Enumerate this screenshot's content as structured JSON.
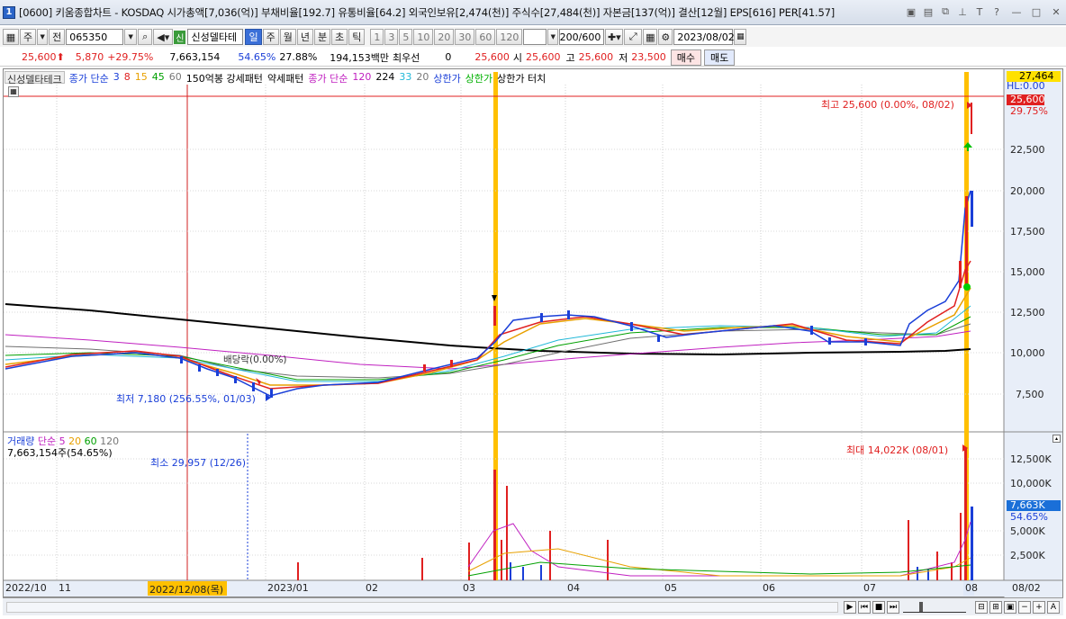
{
  "window": {
    "number": "1",
    "title": "[0600] 키움종합차트 - KOSDAQ 시가총액[7,036(억)] 부채비율[192.7] 유통비율[64.2] 외국인보유[2,474(천)] 주식수[27,484(천)] 자본금[137(억)] 결산[12월] EPS[616] PER[41.57]",
    "title_icons": [
      "layout-icon",
      "window-icon",
      "restore-icon",
      "pin-icon",
      "text-icon",
      "help-icon"
    ]
  },
  "toolbar": {
    "market_type": "주",
    "prev_label": "전",
    "stock_code": "065350",
    "new_badge": "신",
    "stock_name": "신성델타테",
    "periods": [
      "일",
      "주",
      "월",
      "년",
      "분",
      "초",
      "틱"
    ],
    "active_period": "일",
    "intervals": [
      "1",
      "3",
      "5",
      "10",
      "20",
      "30",
      "60",
      "120"
    ],
    "bar_count": "200",
    "bar_total": "/600",
    "date": "2023/08/02"
  },
  "quote": {
    "price": "25,600",
    "change": "5,870",
    "change_pct": "+29.75%",
    "volume": "7,663,154",
    "vol_ratio": "54.65%",
    "turnover": "27.88%",
    "amount": "194,153백만",
    "pref_label": "최우선",
    "pref_value": "0",
    "pref_price": "25,600",
    "open_label": "시",
    "open": "25,600",
    "high_label": "고",
    "high": "25,600",
    "low_label": "저",
    "low": "23,500",
    "buy_label": "매수",
    "sell_label": "매도"
  },
  "legend": {
    "name": "신성델타테크",
    "ma_label": "종가 단순",
    "ma_periods": [
      "3",
      "8",
      "15",
      "45",
      "60"
    ],
    "pattern1": "150억봉 강세패턴",
    "pattern2": "약세패턴",
    "ma2_label": "종가 단순",
    "ma2_periods": [
      "120",
      "224",
      "33",
      "20"
    ],
    "limit_up": "상한가",
    "limit_up2": "상한가",
    "limit_touch": "상한가 터치"
  },
  "annotations": {
    "high_note": "최고 25,600 (0.00%, 08/02)",
    "low_note": "최저 7,180 (256.55%, 01/03)",
    "dividend_note": "배당락(0.00%)",
    "vol_max_note": "최대 14,022K (08/01)",
    "vol_min_note": "최소 29,957 (12/26)"
  },
  "volume_legend": {
    "label": "거래량",
    "ma_label": "단순",
    "periods": [
      "5",
      "20",
      "60",
      "120"
    ],
    "current": "7,663,154주(54.65%)"
  },
  "price_axis": {
    "top_boxes": [
      "27,464",
      "HL:0.00",
      "25,600",
      "29.75%"
    ],
    "ticks": [
      "22,500",
      "20,000",
      "17,500",
      "15,000",
      "12,500",
      "10,000",
      "7,500"
    ]
  },
  "volume_axis": {
    "ticks": [
      "12,500K",
      "10,000K",
      "7,663K",
      "54.65%",
      "5,000K",
      "2,500K"
    ]
  },
  "date_axis": {
    "ticks": [
      "2022/10",
      "11",
      "2022/12/08(목)",
      "2023/01",
      "02",
      "03",
      "04",
      "05",
      "06",
      "07",
      "08",
      "08/02"
    ]
  },
  "colors": {
    "up": "#e02020",
    "down": "#1a3fd8",
    "ma3": "#1a3fd8",
    "ma8": "#e02020",
    "ma15": "#e8a000",
    "ma45": "#00a000",
    "ma60": "#666666",
    "ma120": "#c020c0",
    "ma224": "#000000",
    "ma33": "#20b8d8",
    "highlight": "#ffc000"
  },
  "chart_data": {
    "type": "candlestick",
    "x_range": [
      "2022/10",
      "2023/08/02"
    ],
    "ylim": [
      6500,
      28000
    ],
    "high": {
      "value": 25600,
      "date": "08/02"
    },
    "low": {
      "value": 7180,
      "date": "01/03"
    },
    "last_close": 25600,
    "close_series": [
      {
        "date": "2022/10",
        "value": 9000
      },
      {
        "date": "11",
        "value": 10100
      },
      {
        "date": "2022/12/08",
        "value": 10000
      },
      {
        "date": "2023/01",
        "value": 7500
      },
      {
        "date": "02",
        "value": 8200
      },
      {
        "date": "03",
        "value": 9000
      },
      {
        "date": "03 spike",
        "value": 12300
      },
      {
        "date": "04",
        "value": 12000
      },
      {
        "date": "05",
        "value": 11300
      },
      {
        "date": "06",
        "value": 11700
      },
      {
        "date": "07",
        "value": 10200
      },
      {
        "date": "07 late",
        "value": 13500
      },
      {
        "date": "08/01",
        "value": 19700
      },
      {
        "date": "08/02",
        "value": 25600
      }
    ],
    "ma224": [
      {
        "date": "2022/10",
        "value": 12900
      },
      {
        "date": "03",
        "value": 10400
      },
      {
        "date": "05",
        "value": 10000
      },
      {
        "date": "08/02",
        "value": 10300
      }
    ],
    "volume": {
      "max": {
        "value": 14022,
        "unit": "K",
        "date": "08/01"
      },
      "min": {
        "value": 29957,
        "date": "12/26"
      },
      "last": {
        "value": 7663,
        "unit": "K"
      },
      "ylim": [
        0,
        14000
      ]
    }
  }
}
